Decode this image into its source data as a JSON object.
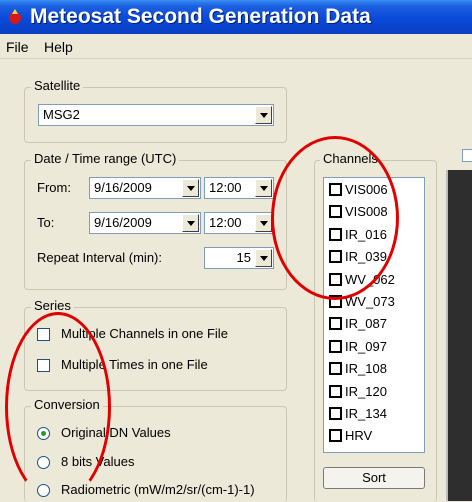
{
  "window": {
    "title": "Meteosat Second Generation Data"
  },
  "menu": [
    {
      "label": "File"
    },
    {
      "label": "Help"
    }
  ],
  "satellite": {
    "group_label": "Satellite",
    "selected": "MSG2"
  },
  "datetime": {
    "group_label": "Date / Time range (UTC)",
    "from_label": "From:",
    "from_date": "9/16/2009",
    "from_time": "12:00",
    "to_label": "To:",
    "to_date": "9/16/2009",
    "to_time": "12:00",
    "repeat_label": "Repeat Interval (min):",
    "repeat_value": "15"
  },
  "series": {
    "group_label": "Series",
    "multi_channels": {
      "label": "Multiple Channels in one File",
      "checked": false
    },
    "multi_times": {
      "label": "Multiple Times in one File",
      "checked": false
    }
  },
  "conversion": {
    "group_label": "Conversion",
    "options": [
      {
        "label": "Original DN Values",
        "selected": true
      },
      {
        "label": "8 bits Values",
        "selected": false
      },
      {
        "label": "Radiometric (mW/m2/sr/(cm-1)-1)",
        "selected": false
      }
    ]
  },
  "channels": {
    "group_label": "Channels",
    "items": [
      "VIS006",
      "VIS008",
      "IR_016",
      "IR_039",
      "WV_062",
      "WV_073",
      "IR_087",
      "IR_097",
      "IR_108",
      "IR_120",
      "IR_134",
      "HRV"
    ],
    "sort_label": "Sort"
  },
  "colors": {
    "title_bar": "#0a49d9",
    "window_bg": "#ece9d8",
    "annotation": "#e00000",
    "radio_selected": "#21a121"
  }
}
